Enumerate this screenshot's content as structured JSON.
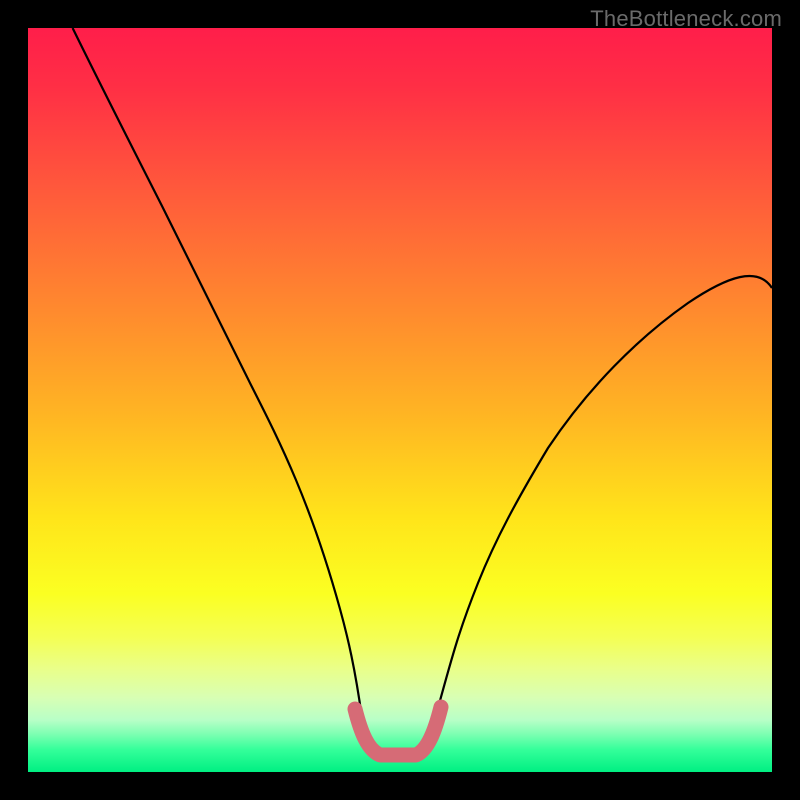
{
  "watermark": {
    "text": "TheBottleneck.com"
  },
  "colors": {
    "curve_stroke": "#000000",
    "pink_stroke": "#d66b76",
    "gradient_top": "#ff1e4a",
    "gradient_bottom": "#00ef82"
  },
  "chart_data": {
    "type": "line",
    "title": "",
    "xlabel": "",
    "ylabel": "",
    "xlim": [
      0,
      100
    ],
    "ylim": [
      0,
      100
    ],
    "grid": false,
    "series": [
      {
        "name": "bottleneck-curve",
        "x": [
          6,
          10,
          14,
          18,
          22,
          26,
          30,
          34,
          38,
          42,
          44,
          46,
          48,
          50,
          52,
          54,
          58,
          62,
          66,
          70,
          74,
          78,
          82,
          86,
          90,
          94,
          98,
          100
        ],
        "y": [
          100,
          92,
          84,
          76,
          68,
          60,
          52,
          44,
          36,
          22,
          13,
          6,
          2,
          2,
          2,
          6,
          16,
          24,
          31,
          37,
          42,
          47,
          51,
          55,
          58,
          61,
          64,
          65
        ]
      }
    ],
    "annotations": [
      {
        "name": "pink-floor-segment",
        "x_range": [
          44,
          54
        ],
        "y": 2
      }
    ]
  }
}
